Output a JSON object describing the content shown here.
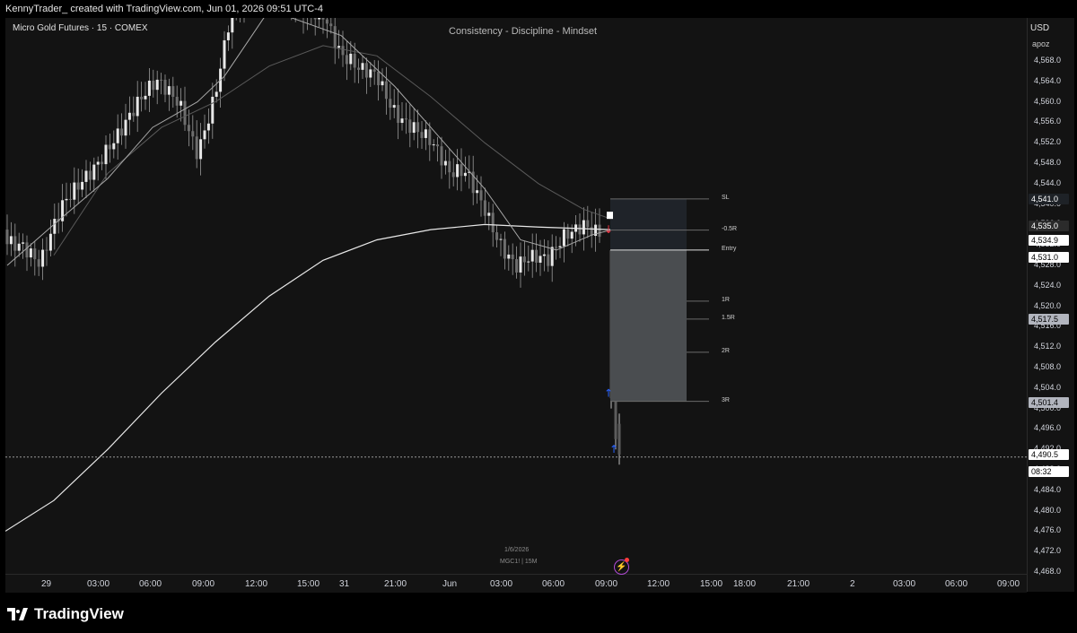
{
  "header": {
    "credit": "KennyTrader_ created with TradingView.com, Jun 01, 2026 09:51 UTC-4"
  },
  "chart": {
    "symbol": "Micro Gold Futures · 15 · COMEX",
    "watermark": "Consistency - Discipline - Mindset",
    "date_label": "1/6/2026",
    "ticker_label": "MGC1! | 15M",
    "currency": "USD",
    "currency_sub": "apoz"
  },
  "price_axis": {
    "ticks": [
      "4,568.0",
      "4,564.0",
      "4,560.0",
      "4,556.0",
      "4,552.0",
      "4,548.0",
      "4,544.0",
      "4,540.0",
      "4,536.0",
      "4,532.0",
      "4,528.0",
      "4,524.0",
      "4,520.0",
      "4,516.0",
      "4,512.0",
      "4,508.0",
      "4,504.0",
      "4,500.0",
      "4,496.0",
      "4,492.0",
      "4,488.0",
      "4,484.0",
      "4,480.0",
      "4,476.0",
      "4,472.0",
      "4,468.0"
    ],
    "tags": {
      "sl": "4,541.0",
      "ma_slow": "4,535.0",
      "neg_half_r": "4,534.9",
      "entry": "4,531.0",
      "r15": "4,517.5",
      "r3": "4,501.4",
      "last": "4,490.5",
      "countdown": "08:32"
    }
  },
  "time_axis": {
    "ticks": [
      "29",
      "03:00",
      "06:00",
      "09:00",
      "12:00",
      "15:00",
      "31",
      "21:00",
      "Jun",
      "03:00",
      "06:00",
      "09:00",
      "12:00",
      "15:00",
      "18:00",
      "21:00",
      "2",
      "03:00",
      "06:00",
      "09:00"
    ]
  },
  "position_tool": {
    "labels": [
      "SL",
      "-0.5R",
      "Entry",
      "1R",
      "1.5R",
      "2R",
      "3R"
    ]
  },
  "colors": {
    "background": "#131313",
    "candle": "#cfcfcf",
    "stop_zone": "#1f2329",
    "target_zone": "#4a4d50",
    "buy_arrow": "#2962ff",
    "sell_arrow": "#f23645",
    "alert": "#b14bd6"
  },
  "icons": {
    "alert": "lightning-icon",
    "logo": "tradingview-logo-icon"
  },
  "branding": {
    "logo_text": "TradingView"
  },
  "chart_data": {
    "type": "candlestick",
    "ylim": [
      4468.0,
      4571.0
    ],
    "current_price": 4490.5,
    "levels": {
      "stop_loss": 4541.0,
      "entry": 4531.0,
      "neg_half_r": 4534.9,
      "r1": 4521.0,
      "r1_5": 4517.5,
      "r2": 4511.0,
      "r3": 4501.4
    }
  }
}
